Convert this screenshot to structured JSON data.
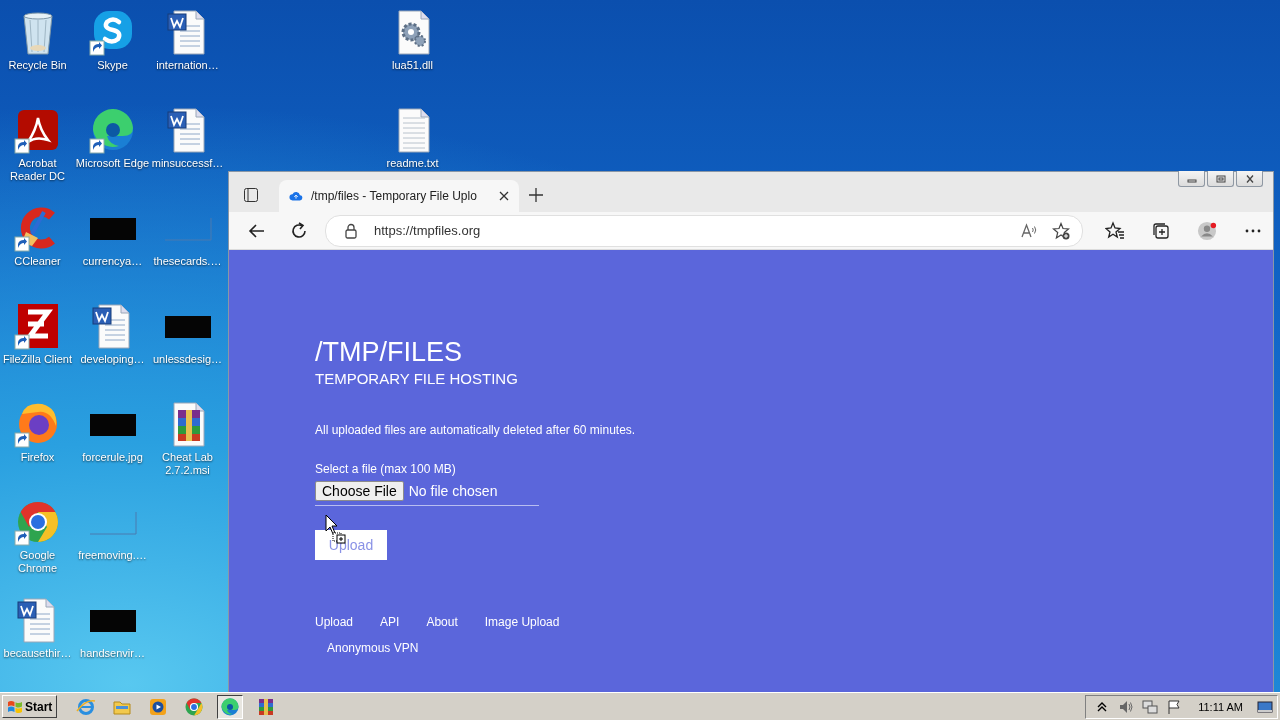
{
  "desktop": {
    "columns": [
      {
        "icons": [
          {
            "label": "Recycle Bin",
            "kind": "recycle-bin",
            "shortcut": false
          },
          {
            "label": "Acrobat Reader DC",
            "kind": "acrobat",
            "shortcut": true
          },
          {
            "label": "CCleaner",
            "kind": "ccleaner",
            "shortcut": true
          },
          {
            "label": "FileZilla Client",
            "kind": "filezilla",
            "shortcut": true
          },
          {
            "label": "Firefox",
            "kind": "firefox",
            "shortcut": true
          },
          {
            "label": "Google Chrome",
            "kind": "chrome",
            "shortcut": true
          },
          {
            "label": "becausethir…",
            "kind": "word",
            "shortcut": false
          }
        ]
      },
      {
        "icons": [
          {
            "label": "Skype",
            "kind": "skype",
            "shortcut": true
          },
          {
            "label": "Microsoft Edge",
            "kind": "edge",
            "shortcut": true
          },
          {
            "label": "currencya…",
            "kind": "dark-thumbnail",
            "shortcut": false
          },
          {
            "label": "developing…",
            "kind": "word",
            "shortcut": false
          },
          {
            "label": "forcerule.jpg",
            "kind": "dark-thumbnail",
            "shortcut": false
          },
          {
            "label": "freemoving.…",
            "kind": "blank-thumbnail",
            "shortcut": false
          },
          {
            "label": "handsenvir…",
            "kind": "dark-thumbnail",
            "shortcut": false
          }
        ]
      },
      {
        "icons": [
          {
            "label": "internation…",
            "kind": "word",
            "shortcut": false
          },
          {
            "label": "minsuccessf…",
            "kind": "word",
            "shortcut": false
          },
          {
            "label": "thesecards.…",
            "kind": "blank-thumbnail",
            "shortcut": false
          },
          {
            "label": "unlessdesig…",
            "kind": "dark-thumbnail",
            "shortcut": false
          },
          {
            "label": "Cheat Lab 2.7.2.msi",
            "kind": "archive",
            "shortcut": false
          }
        ]
      },
      {
        "icons": [
          {
            "label": "lua51.dll",
            "kind": "dll",
            "shortcut": false
          },
          {
            "label": "readme.txt",
            "kind": "txt",
            "shortcut": false
          }
        ]
      }
    ]
  },
  "browser": {
    "tab_title": "/tmp/files - Temporary File Uplo",
    "address": "https://tmpfiles.org",
    "page": {
      "title": "/TMP/FILES",
      "subtitle": "TEMPORARY FILE HOSTING",
      "notice": "All uploaded files are automatically deleted after 60 minutes.",
      "file_label": "Select a file (max 100 MB)",
      "choose_button": "Choose File",
      "file_status": "No file chosen",
      "upload_button": "Upload",
      "footer_links": [
        "Upload",
        "API",
        "About",
        "Image Upload",
        "Anonymous VPN"
      ]
    }
  },
  "taskbar": {
    "start": "Start",
    "apps": [
      {
        "kind": "ie",
        "selected": false
      },
      {
        "kind": "explorer",
        "selected": false
      },
      {
        "kind": "media",
        "selected": false
      },
      {
        "kind": "chrome",
        "selected": false
      },
      {
        "kind": "edge",
        "selected": true
      },
      {
        "kind": "archive",
        "selected": false
      }
    ],
    "clock": "11:11 AM"
  }
}
